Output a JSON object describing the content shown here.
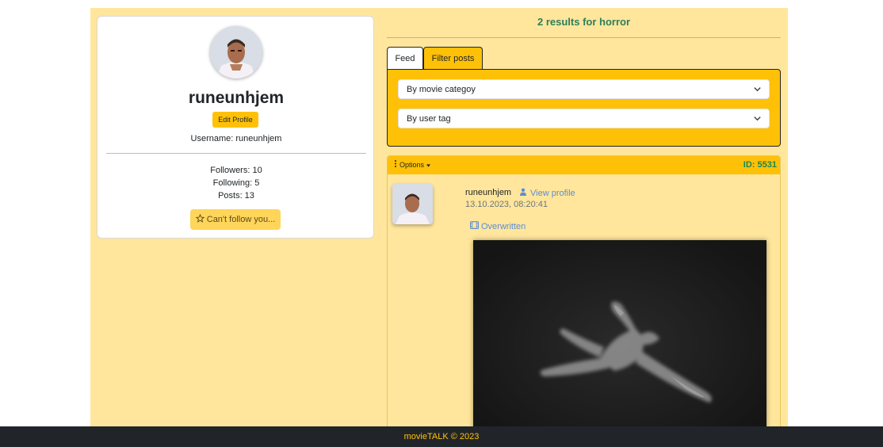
{
  "profile": {
    "username": "runeunhjem",
    "edit_label": "Edit Profile",
    "username_line": "Username: runeunhjem",
    "followers": "Followers: 10",
    "following": "Following: 5",
    "posts": "Posts: 13",
    "follow_label": "Can't follow you..."
  },
  "results": {
    "text": "2 results for horror"
  },
  "tabs": [
    {
      "label": "Feed"
    },
    {
      "label": "Filter posts"
    }
  ],
  "filters": {
    "category": "By movie categoy",
    "tag": "By user tag"
  },
  "post": {
    "options_label": "Options",
    "id": "ID: 5531",
    "author": "runeunhjem",
    "view_profile": "View profile",
    "timestamp": "13.10.2023, 08:20:41",
    "movie_title": "Overwritten"
  },
  "footer": {
    "text": "movieTALK © 2023"
  },
  "colors": {
    "accent": "#ffc107",
    "background": "#ffe69c",
    "footer_bg": "#212529",
    "id_green": "#198754",
    "link_blue": "#5b8dd6"
  },
  "icons": {
    "follow": "star-outline-icon",
    "options": "vertical-dots-icon",
    "profile": "person-icon",
    "movie": "film-icon",
    "select": "chevron-down-icon"
  }
}
